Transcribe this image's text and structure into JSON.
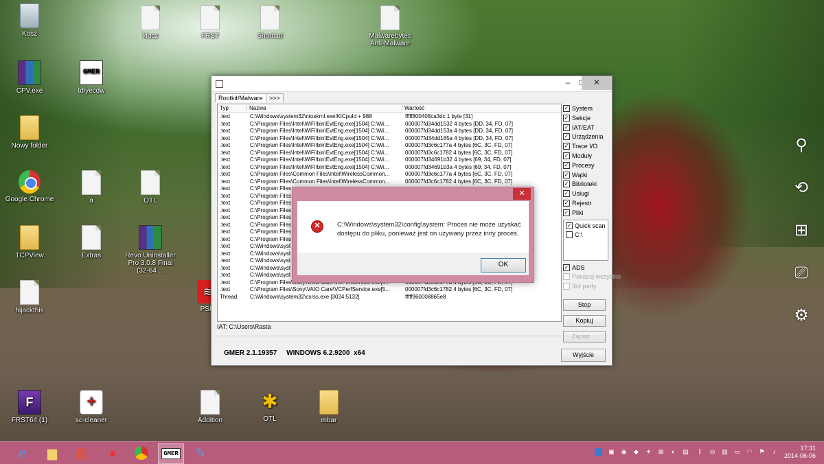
{
  "desktop": {
    "icons": [
      {
        "label": "Kosz",
        "kind": "recycle"
      },
      {
        "label": "klucz",
        "kind": "doc"
      },
      {
        "label": "FRST",
        "kind": "doc"
      },
      {
        "label": "Shortcut",
        "kind": "doc"
      },
      {
        "label": "Malwarebytes Anti-Malware",
        "kind": "doc"
      },
      {
        "label": "CPV.exe",
        "kind": "rar"
      },
      {
        "label": "tdlyecdw",
        "kind": "gmer"
      },
      {
        "label": "Nowy folder",
        "kind": "folder"
      },
      {
        "label": "Google Chrome",
        "kind": "chrome"
      },
      {
        "label": "a",
        "kind": "doc"
      },
      {
        "label": "OTL",
        "kind": "doc"
      },
      {
        "label": "TCPView",
        "kind": "folder"
      },
      {
        "label": "Extras",
        "kind": "doc"
      },
      {
        "label": "Revo Uninstaller Pro 3.0.8 Final (32-64 ...",
        "kind": "rar"
      },
      {
        "label": "hijackthis",
        "kind": "doc"
      },
      {
        "label": "PSIS",
        "kind": "psi"
      },
      {
        "label": "FRST64 (1)",
        "kind": "frst"
      },
      {
        "label": "sc-cleaner",
        "kind": "sc"
      },
      {
        "label": "Addition",
        "kind": "doc"
      },
      {
        "label": "OTL",
        "kind": "otl"
      },
      {
        "label": "mbar",
        "kind": "folder"
      }
    ]
  },
  "gmer": {
    "tabs": [
      "Rootkit/Malware",
      ">>>"
    ],
    "columns": {
      "type": "Typ",
      "name": "Nazwa",
      "value": "Wartość"
    },
    "rows": [
      {
        "type": ".text",
        "name": "C:\\Windows\\system32\\ntoskrnl.exe!KiCpuId + 988",
        "value": "fffff800408ca3dc 1 byte [31]"
      },
      {
        "type": ".text",
        "name": "C:\\Program Files\\Intel\\WiFi\\bin\\EvtEng.exe[1504] C:\\Wi...",
        "value": "000007fd34dd1532 4 bytes [DD, 34, FD, 07]"
      },
      {
        "type": ".text",
        "name": "C:\\Program Files\\Intel\\WiFi\\bin\\EvtEng.exe[1504] C:\\Wi...",
        "value": "000007fd34dd153a 4 bytes [DD, 34, FD, 07]"
      },
      {
        "type": ".text",
        "name": "C:\\Program Files\\Intel\\WiFi\\bin\\EvtEng.exe[1504] C:\\Wi...",
        "value": "000007fd34dd165a 4 bytes [DD, 34, FD, 07]"
      },
      {
        "type": ".text",
        "name": "C:\\Program Files\\Intel\\WiFi\\bin\\EvtEng.exe[1504] C:\\Wi...",
        "value": "000007fd3c6c177a 4 bytes [6C, 3C, FD, 07]"
      },
      {
        "type": ".text",
        "name": "C:\\Program Files\\Intel\\WiFi\\bin\\EvtEng.exe[1504] C:\\Wi...",
        "value": "000007fd3c6c1782 4 bytes [6C, 3C, FD, 07]"
      },
      {
        "type": ".text",
        "name": "C:\\Program Files\\Intel\\WiFi\\bin\\EvtEng.exe[1504] C:\\Wi...",
        "value": "000007fd34691b32 4 bytes [69, 34, FD, 07]"
      },
      {
        "type": ".text",
        "name": "C:\\Program Files\\Intel\\WiFi\\bin\\EvtEng.exe[1504] C:\\Wi...",
        "value": "000007fd34691b3a 4 bytes [69, 34, FD, 07]"
      },
      {
        "type": ".text",
        "name": "C:\\Program Files\\Common Files\\Intel\\WirelessCommon...",
        "value": "000007fd3c6c177a 4 bytes [6C, 3C, FD, 07]"
      },
      {
        "type": ".text",
        "name": "C:\\Program Files\\Common Files\\Intel\\WirelessCommon...",
        "value": "000007fd3c6c1782 4 bytes [6C, 3C, FD, 07]"
      },
      {
        "type": ".text",
        "name": "C:\\Program Files",
        "value": ""
      },
      {
        "type": ".text",
        "name": "C:\\Program Files",
        "value": ""
      },
      {
        "type": ".text",
        "name": "C:\\Program Files",
        "value": ""
      },
      {
        "type": ".text",
        "name": "C:\\Program Files",
        "value": ""
      },
      {
        "type": ".text",
        "name": "C:\\Program Files",
        "value": ""
      },
      {
        "type": ".text",
        "name": "C:\\Program Files",
        "value": ""
      },
      {
        "type": ".text",
        "name": "C:\\Program Files",
        "value": ""
      },
      {
        "type": ".text",
        "name": "C:\\Program Files",
        "value": ""
      },
      {
        "type": ".text",
        "name": "C:\\Windows\\syst",
        "value": ""
      },
      {
        "type": ".text",
        "name": "C:\\Windows\\syst",
        "value": ""
      },
      {
        "type": ".text",
        "name": "C:\\Windows\\syst",
        "value": ""
      },
      {
        "type": ".text",
        "name": "C:\\Windows\\syst",
        "value": ""
      },
      {
        "type": ".text",
        "name": "C:\\Windows\\syst",
        "value": ""
      },
      {
        "type": ".text",
        "name": "C:\\Program Files\\Sony\\VAIO Care\\VCPerfService.exe[5...",
        "value": "000007fd3c6c177a 4 bytes [6C, 3C, FD, 07]"
      },
      {
        "type": ".text",
        "name": "C:\\Program Files\\Sony\\VAIO Care\\VCPerfService.exe[5...",
        "value": "000007fd3c6c1782 4 bytes [6C, 3C, FD, 07]"
      },
      {
        "type": "Thread",
        "name": "C:\\Windows\\system32\\csrss.exe [3024:5132]",
        "value": "fffff960008865e8"
      }
    ],
    "options": [
      {
        "label": "System",
        "checked": true
      },
      {
        "label": "Sekcje",
        "checked": true
      },
      {
        "label": "IAT/EAT",
        "checked": true
      },
      {
        "label": "Urządzenia",
        "checked": true
      },
      {
        "label": "Trace I/O",
        "checked": true
      },
      {
        "label": "Moduły",
        "checked": true
      },
      {
        "label": "Procesy",
        "checked": true
      },
      {
        "label": "Wątki",
        "checked": true
      },
      {
        "label": "Biblioteki",
        "checked": true
      },
      {
        "label": "Usługi",
        "checked": true
      },
      {
        "label": "Rejestr",
        "checked": true
      },
      {
        "label": "Pliki",
        "checked": true
      }
    ],
    "drives": [
      {
        "label": "Quick scan",
        "checked": true
      },
      {
        "label": "C:\\",
        "checked": false
      }
    ],
    "extra_options": [
      {
        "label": "ADS",
        "checked": true,
        "disabled": false
      },
      {
        "label": "Pokazuj wszystko",
        "checked": false,
        "disabled": true
      },
      {
        "label": "3rd party",
        "checked": false,
        "disabled": true
      }
    ],
    "buttons": {
      "stop": "Stop",
      "copy": "Kopiuj",
      "save": "Zapisz ...",
      "exit": "Wyjście"
    },
    "iat_text": "IAT: C:\\Users\\Rasta",
    "status": "GMER 2.1.19357     WINDOWS 6.2.9200  x64"
  },
  "dialog": {
    "message_line1": "C:\\Windows\\system32\\config\\system: Proces nie może uzyskać",
    "message_line2": "dostępu do pliku, ponieważ jest on używany przez inny proces.",
    "ok_label": "OK",
    "close_glyph": "✕"
  },
  "taskbar": {
    "time": "17:31",
    "date": "2014-06-06"
  },
  "colors": {
    "taskbar": "#b85c7c",
    "dialog_frame": "#cf8ba4",
    "error": "#d42a2a"
  }
}
